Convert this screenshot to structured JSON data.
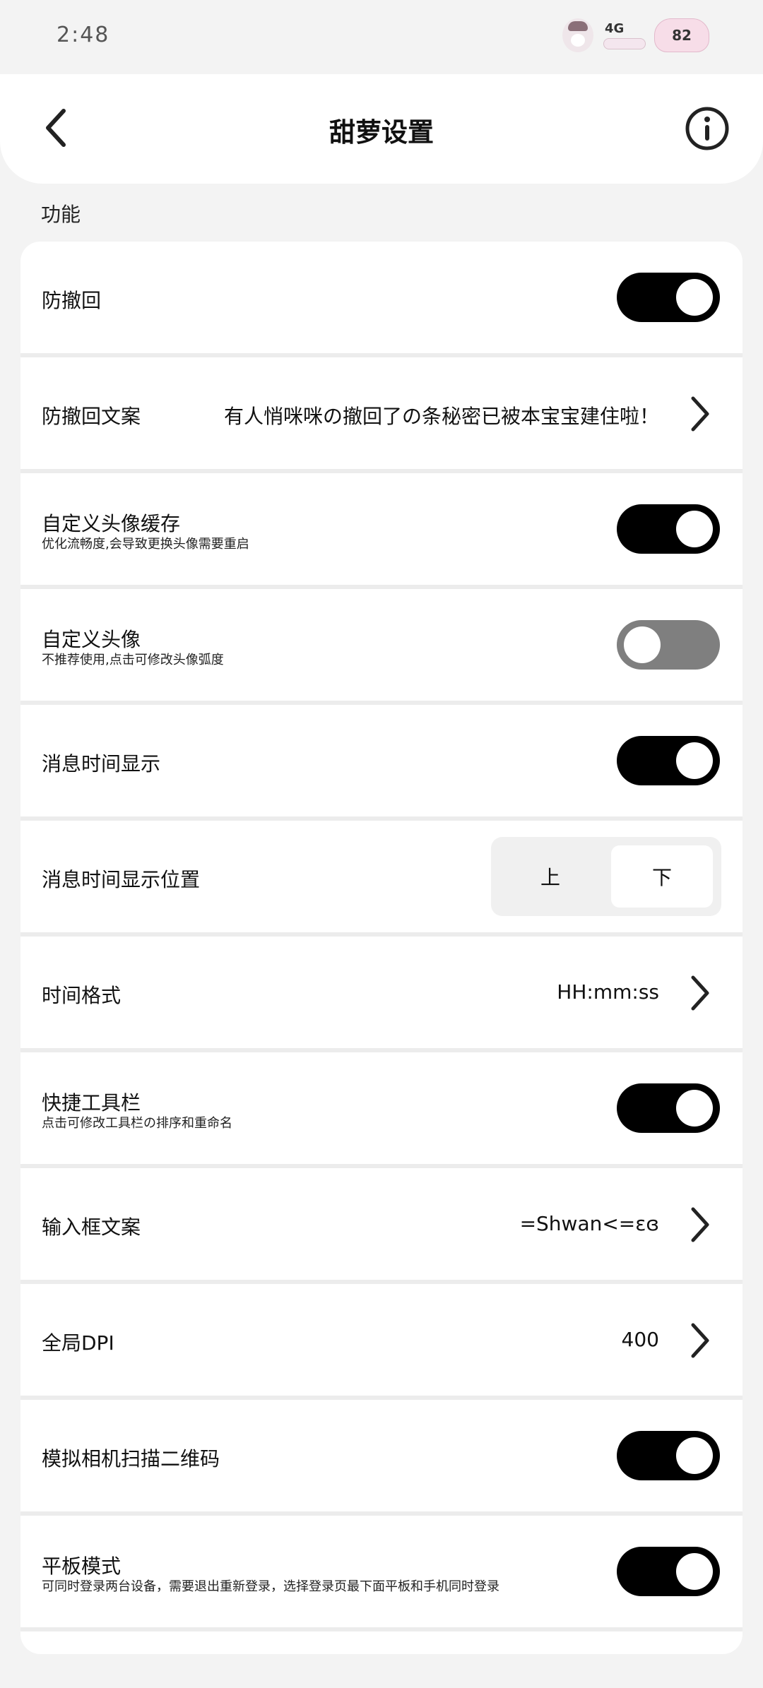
{
  "status_bar": {
    "time": "2:48",
    "network": "4G",
    "battery": "82"
  },
  "header": {
    "title": "甜萝设置"
  },
  "section": {
    "label": "功能"
  },
  "settings": {
    "anti_recall": {
      "title": "防撤回",
      "enabled": true
    },
    "anti_recall_text": {
      "title": "防撤回文案",
      "value": "有人悄咪咪の撤回了の条秘密已被本宝宝建住啦！"
    },
    "avatar_cache": {
      "title": "自定义头像缓存",
      "subtitle": "优化流畅度,会导致更换头像需要重启",
      "enabled": true
    },
    "custom_avatar": {
      "title": "自定义头像",
      "subtitle": "不推荐使用,点击可修改头像弧度",
      "enabled": false
    },
    "msg_time_display": {
      "title": "消息时间显示",
      "enabled": true
    },
    "msg_time_position": {
      "title": "消息时间显示位置",
      "options": [
        "上",
        "下"
      ],
      "selected": "下"
    },
    "time_format": {
      "title": "时间格式",
      "value": "HH:mm:ss"
    },
    "quick_toolbar": {
      "title": "快捷工具栏",
      "subtitle": "点击可修改工具栏の排序和重命名",
      "enabled": true
    },
    "input_box_text": {
      "title": "输入框文案",
      "value": "=Shwan<=ɛɞ"
    },
    "global_dpi": {
      "title": "全局DPI",
      "value": "400"
    },
    "camera_qr": {
      "title": "模拟相机扫描二维码",
      "enabled": true
    },
    "tablet_mode": {
      "title": "平板模式",
      "subtitle": "可同时登录两台设备，需要退出重新登录，选择登录页最下面平板和手机同时登录",
      "enabled": true
    }
  },
  "colors": {
    "toggle_on": "#000000",
    "toggle_off": "#7f7f7f",
    "background": "#f3f3f3",
    "card": "#ffffff"
  }
}
